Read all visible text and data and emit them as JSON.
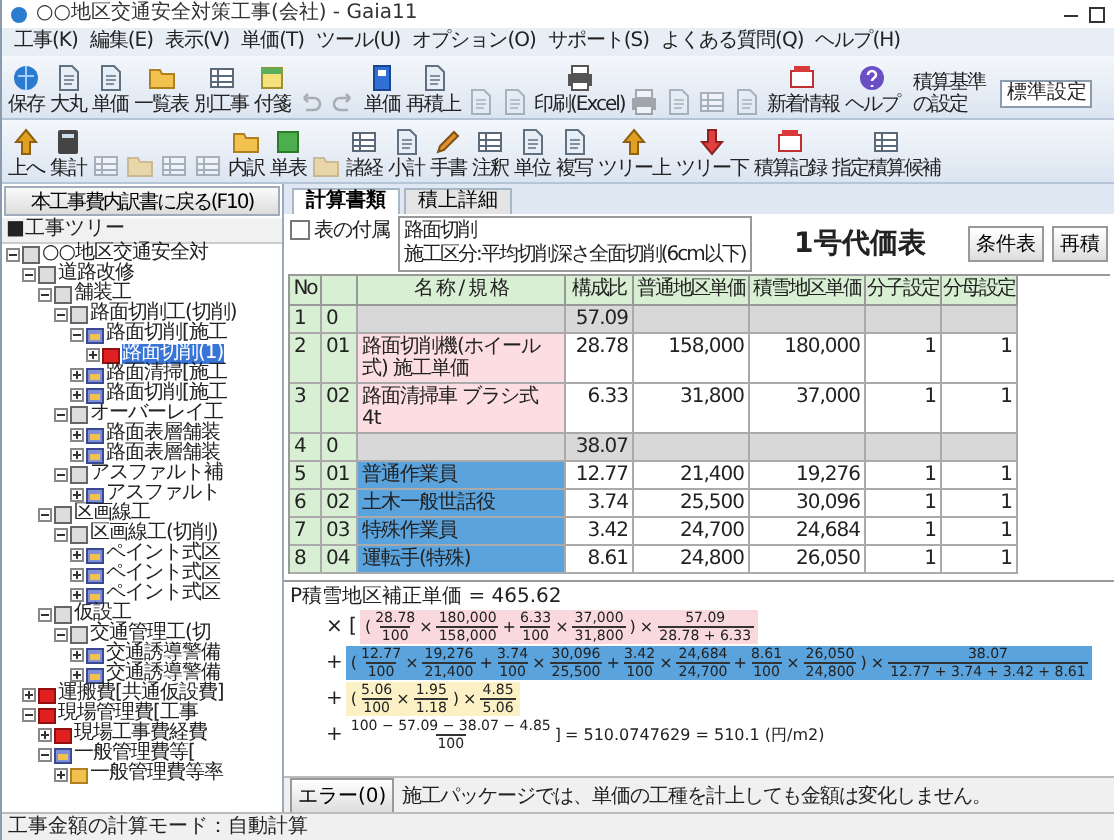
{
  "window": {
    "title": "○○地区交通安全対策工事(会社) - Gaia11"
  },
  "menu": [
    "工事(K)",
    "編集(E)",
    "表示(V)",
    "単価(T)",
    "ツール(U)",
    "オプション(O)",
    "サポート(S)",
    "よくある質問(Q)",
    "ヘルプ(H)"
  ],
  "toolbar_1": [
    {
      "label": "保存",
      "kind": "globe",
      "disabled": false
    },
    {
      "label": "大丸",
      "kind": "doc",
      "disabled": false
    },
    {
      "label": "単価",
      "kind": "doc",
      "disabled": false
    },
    {
      "label": "一覧表",
      "kind": "folder",
      "disabled": false
    },
    {
      "label": "別工事",
      "kind": "grid",
      "disabled": false
    },
    {
      "label": "付箋",
      "kind": "note",
      "disabled": false
    },
    {
      "kind": "undo",
      "disabled": true
    },
    {
      "kind": "redo",
      "disabled": true
    },
    {
      "label": "単価",
      "kind": "book",
      "disabled": false
    },
    {
      "label": "再積上",
      "kind": "doc",
      "disabled": false
    },
    {
      "kind": "doc",
      "disabled": true
    },
    {
      "kind": "doc",
      "disabled": true
    },
    {
      "label": "印刷(Excel)",
      "kind": "printer",
      "disabled": false
    },
    {
      "kind": "printer",
      "disabled": true
    },
    {
      "kind": "doc",
      "disabled": true
    },
    {
      "kind": "grid",
      "disabled": true
    },
    {
      "kind": "doc",
      "disabled": true
    },
    {
      "label": "新着情報",
      "kind": "news",
      "disabled": false
    },
    {
      "label": "ヘルプ",
      "kind": "help",
      "disabled": false
    }
  ],
  "standard_setting": {
    "label": "積算基準の設定",
    "value": "標準設定"
  },
  "toolbar_2": [
    {
      "label": "上へ",
      "kind": "up",
      "disabled": false
    },
    {
      "label": "集計",
      "kind": "calc",
      "disabled": false
    },
    {
      "kind": "grid",
      "disabled": true
    },
    {
      "kind": "folder",
      "disabled": true
    },
    {
      "kind": "grid",
      "disabled": true
    },
    {
      "kind": "grid",
      "disabled": true
    },
    {
      "label": "内訳",
      "kind": "folder",
      "disabled": false
    },
    {
      "label": "単表",
      "kind": "green",
      "disabled": false
    },
    {
      "kind": "folder",
      "disabled": true
    },
    {
      "label": "諸経",
      "kind": "grid",
      "disabled": false
    },
    {
      "label": "小計",
      "kind": "doc",
      "disabled": false
    },
    {
      "label": "手書",
      "kind": "pencil",
      "disabled": false
    },
    {
      "label": "注釈",
      "kind": "grid",
      "disabled": false
    },
    {
      "label": "単位",
      "kind": "doc",
      "disabled": false
    },
    {
      "label": "複写",
      "kind": "doc",
      "disabled": false
    },
    {
      "label": "ツリー上",
      "kind": "up",
      "disabled": false
    },
    {
      "label": "ツリー下",
      "kind": "down",
      "disabled": false
    },
    {
      "label": "積算記録",
      "kind": "news",
      "disabled": false
    },
    {
      "label": "指定積算候補",
      "kind": "grid",
      "disabled": false
    }
  ],
  "sidebar": {
    "back_button": "本工事費内訳書に戻る(F10)",
    "tree_title": "■工事ツリー",
    "tree": [
      {
        "label": "○○地区交通安全対",
        "kind": "root",
        "expanded": true,
        "selected": false,
        "children": [
          {
            "label": "道路改修",
            "kind": "group",
            "expanded": true,
            "selected": false,
            "children": [
              {
                "label": "舗装工",
                "kind": "group",
                "expanded": true,
                "selected": false,
                "children": [
                  {
                    "label": "路面切削工(切削)",
                    "kind": "group",
                    "expanded": true,
                    "selected": false,
                    "children": [
                      {
                        "label": "路面切削[施工",
                        "kind": "folder",
                        "expanded": true,
                        "selected": false,
                        "children": [
                          {
                            "label": "路面切削(1)",
                            "kind": "red",
                            "expanded": false,
                            "selected": true
                          }
                        ]
                      },
                      {
                        "label": "路面清掃[施工",
                        "kind": "folder",
                        "expanded": false,
                        "selected": false
                      },
                      {
                        "label": "路面切削[施工",
                        "kind": "folder",
                        "expanded": false,
                        "selected": false
                      }
                    ]
                  },
                  {
                    "label": "オーバーレイ工",
                    "kind": "group",
                    "expanded": true,
                    "selected": false,
                    "children": [
                      {
                        "label": "路面表層舗装",
                        "kind": "folder",
                        "expanded": false,
                        "selected": false
                      },
                      {
                        "label": "路面表層舗装",
                        "kind": "folder",
                        "expanded": false,
                        "selected": false
                      }
                    ]
                  },
                  {
                    "label": "アスファルト補",
                    "kind": "group",
                    "expanded": true,
                    "selected": false,
                    "children": [
                      {
                        "label": "アスファルト",
                        "kind": "folder",
                        "expanded": false,
                        "selected": false
                      }
                    ]
                  }
                ]
              },
              {
                "label": "区画線工",
                "kind": "group",
                "expanded": true,
                "selected": false,
                "children": [
                  {
                    "label": "区画線工(切削)",
                    "kind": "group",
                    "expanded": true,
                    "selected": false,
                    "children": [
                      {
                        "label": "ペイント式区",
                        "kind": "folder",
                        "expanded": false,
                        "selected": false
                      },
                      {
                        "label": "ペイント式区",
                        "kind": "folder",
                        "expanded": false,
                        "selected": false
                      },
                      {
                        "label": "ペイント式区",
                        "kind": "folder",
                        "expanded": false,
                        "selected": false
                      }
                    ]
                  }
                ]
              },
              {
                "label": "仮設工",
                "kind": "group",
                "expanded": true,
                "selected": false,
                "children": [
                  {
                    "label": "交通管理工(切",
                    "kind": "group",
                    "expanded": true,
                    "selected": false,
                    "children": [
                      {
                        "label": "交通誘導警備",
                        "kind": "folder",
                        "expanded": false,
                        "selected": false
                      },
                      {
                        "label": "交通誘導警備",
                        "kind": "folder",
                        "expanded": false,
                        "selected": false
                      }
                    ]
                  }
                ]
              }
            ]
          },
          {
            "label": "運搬費[共通仮設費]",
            "kind": "red",
            "expanded": false,
            "selected": false
          },
          {
            "label": "現場管理費[工事",
            "kind": "red",
            "expanded": true,
            "selected": false,
            "children": [
              {
                "label": "現場工事費経費",
                "kind": "red",
                "expanded": false,
                "selected": false
              },
              {
                "label": "一般管理費等[",
                "kind": "folder",
                "expanded": true,
                "selected": false,
                "children": [
                  {
                    "label": "一般管理費等率",
                    "kind": "yellow",
                    "expanded": false,
                    "selected": false
                  }
                ]
              }
            ]
          }
        ]
      }
    ]
  },
  "tabs": [
    {
      "label": "計算書類",
      "selected": true
    },
    {
      "label": "積上詳細",
      "selected": false
    }
  ],
  "header": {
    "checkbox": {
      "label": "表の付属",
      "checked": false
    },
    "lines": [
      "路面切削",
      "施工区分:平均切削深さ全面切削(6cm以下)"
    ],
    "title": "1号代価表",
    "buttons": [
      "条件表",
      "再積"
    ]
  },
  "table": {
    "columns": [
      "No",
      null,
      "名 称 / 規 格",
      "構成比",
      "普通地区単価",
      "積雪地区単価",
      "分子設定",
      "分母設定"
    ],
    "rows": [
      {
        "kind": "group",
        "cells": [
          "1",
          "0",
          null,
          "57.09",
          null,
          null,
          null,
          null
        ]
      },
      {
        "kind": "machine",
        "cells": [
          "2",
          "01",
          "路面切削機(ホイール式) 施工単価",
          "28.78",
          "158,000",
          "180,000",
          "1",
          "1"
        ]
      },
      {
        "kind": "machine",
        "cells": [
          "3",
          "02",
          "路面清掃車 ブラシ式 4t",
          "6.33",
          "31,800",
          "37,000",
          "1",
          "1"
        ]
      },
      {
        "kind": "group",
        "cells": [
          "4",
          "0",
          null,
          "38.07",
          null,
          null,
          null,
          null
        ]
      },
      {
        "kind": "labor",
        "cells": [
          "5",
          "01",
          "普通作業員",
          "12.77",
          "21,400",
          "19,276",
          "1",
          "1"
        ]
      },
      {
        "kind": "labor",
        "cells": [
          "6",
          "02",
          "土木一般世話役",
          "3.74",
          "25,500",
          "30,096",
          "1",
          "1"
        ]
      },
      {
        "kind": "labor",
        "cells": [
          "7",
          "03",
          "特殊作業員",
          "3.42",
          "24,700",
          "24,684",
          "1",
          "1"
        ]
      },
      {
        "kind": "labor",
        "cells": [
          "8",
          "04",
          "運転手(特殊)",
          "8.61",
          "24,800",
          "26,050",
          "1",
          "1"
        ]
      }
    ]
  },
  "formula": {
    "title": "P積雪地区補正単価 = 465.62",
    "lines": [
      {
        "kind": "pink",
        "prefix": "× [",
        "terms": [
          {
            "kind": "op",
            "text": "("
          },
          {
            "kind": "fraction",
            "numerator": "28.78",
            "denominator": "100"
          },
          {
            "kind": "op",
            "text": "×"
          },
          {
            "kind": "fraction",
            "numerator": "180,000",
            "denominator": "158,000"
          },
          {
            "kind": "op",
            "text": "+"
          },
          {
            "kind": "fraction",
            "numerator": "6.33",
            "denominator": "100"
          },
          {
            "kind": "op",
            "text": "×"
          },
          {
            "kind": "fraction",
            "numerator": "37,000",
            "denominator": "31,800"
          },
          {
            "kind": "op",
            "text": ")"
          },
          {
            "kind": "op",
            "text": "×"
          },
          {
            "kind": "fraction",
            "numerator": "57.09",
            "denominator": "28.78 + 6.33"
          }
        ]
      },
      {
        "kind": "blue",
        "prefix": "+",
        "terms": [
          {
            "kind": "op",
            "text": "("
          },
          {
            "kind": "fraction",
            "numerator": "12.77",
            "denominator": "100"
          },
          {
            "kind": "op",
            "text": "×"
          },
          {
            "kind": "fraction",
            "numerator": "19,276",
            "denominator": "21,400"
          },
          {
            "kind": "op",
            "text": "+"
          },
          {
            "kind": "fraction",
            "numerator": "3.74",
            "denominator": "100"
          },
          {
            "kind": "op",
            "text": "×"
          },
          {
            "kind": "fraction",
            "numerator": "30,096",
            "denominator": "25,500"
          },
          {
            "kind": "op",
            "text": "+"
          },
          {
            "kind": "fraction",
            "numerator": "3.42",
            "denominator": "100"
          },
          {
            "kind": "op",
            "text": "×"
          },
          {
            "kind": "fraction",
            "numerator": "24,684",
            "denominator": "24,700"
          },
          {
            "kind": "op",
            "text": "+"
          },
          {
            "kind": "fraction",
            "numerator": "8.61",
            "denominator": "100"
          },
          {
            "kind": "op",
            "text": "×"
          },
          {
            "kind": "fraction",
            "numerator": "26,050",
            "denominator": "24,800"
          },
          {
            "kind": "op",
            "text": ")"
          },
          {
            "kind": "op",
            "text": "×"
          },
          {
            "kind": "fraction",
            "numerator": "38.07",
            "denominator": "12.77 + 3.74 + 3.42 + 8.61"
          }
        ]
      },
      {
        "kind": "yellow",
        "prefix": "+",
        "terms": [
          {
            "kind": "op",
            "text": "("
          },
          {
            "kind": "fraction",
            "numerator": "5.06",
            "denominator": "100"
          },
          {
            "kind": "op",
            "text": "×"
          },
          {
            "kind": "fraction",
            "numerator": "1.95",
            "denominator": "1.18"
          },
          {
            "kind": "op",
            "text": ")"
          },
          {
            "kind": "op",
            "text": "×"
          },
          {
            "kind": "fraction",
            "numerator": "4.85",
            "denominator": "5.06"
          }
        ]
      },
      {
        "kind": "plain",
        "prefix": "+",
        "terms": [
          {
            "kind": "fraction",
            "numerator": "100 − 57.09 − 38.07 − 4.85",
            "denominator": "100"
          },
          {
            "kind": "op",
            "text": "]"
          },
          {
            "kind": "op",
            "text": "= 510.0747629 = 510.1 (円/m2)"
          }
        ]
      }
    ]
  },
  "footer": {
    "button": "エラー(0)",
    "message": "施工パッケージでは、単価の工種を計上しても金額は変化しません。"
  },
  "status_bar": "工事金額の計算モード：自動計算"
}
